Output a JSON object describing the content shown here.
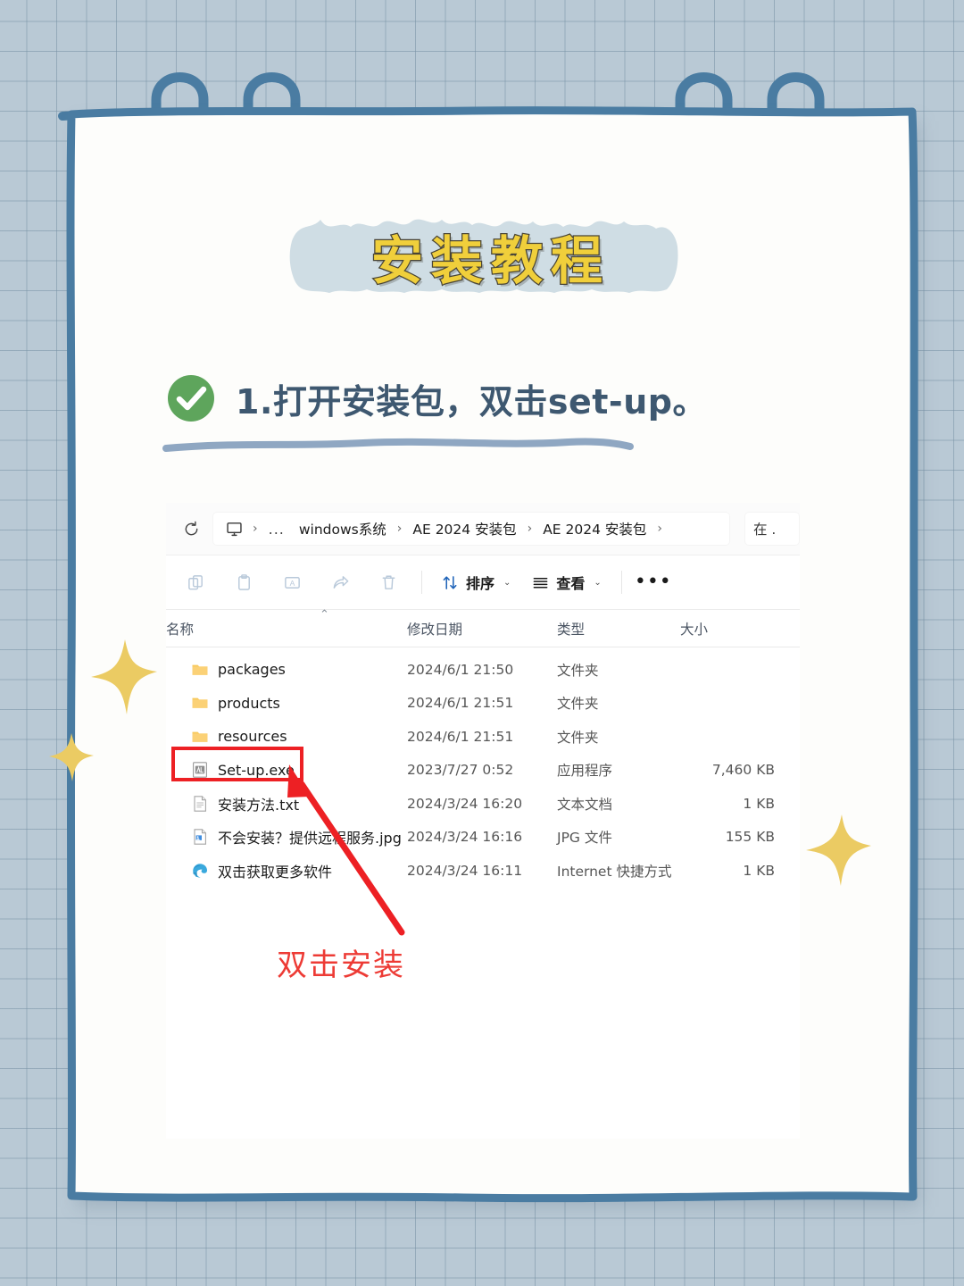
{
  "poster": {
    "title": "安装教程",
    "step": {
      "icon": "green-check-circle-icon",
      "text": "1.打开安装包，双击set-up。"
    },
    "annotation": "双击安装"
  },
  "colors": {
    "background": "#b9c9d5",
    "sheet": "#fdfdfb",
    "ring_blue": "#4a7ca2",
    "title_fill": "#F0CF3B",
    "title_stroke": "#4a4535",
    "highlight_brush": "#cfdde4",
    "heading_text": "#3e5870",
    "check_green": "#5EA55C",
    "star_yellow": "#EBCB63",
    "annotation_red": "#ED3B35",
    "highlight_box_red": "#ED2024"
  },
  "explorer": {
    "address_bar": {
      "refresh_icon": "refresh-icon",
      "pc_icon": "this-pc-monitor-icon",
      "breadcrumb": [
        {
          "label": "›",
          "type": "separator"
        },
        {
          "label": "...",
          "type": "overflow"
        },
        {
          "label": "windows系统",
          "type": "crumb"
        },
        {
          "label": "›",
          "type": "separator"
        },
        {
          "label": "AE 2024 安装包",
          "type": "crumb"
        },
        {
          "label": "›",
          "type": "separator"
        },
        {
          "label": "AE 2024 安装包",
          "type": "crumb"
        },
        {
          "label": "›",
          "type": "separator"
        }
      ],
      "search_partial": "在 ."
    },
    "command_bar": {
      "icons": [
        "copy-icon",
        "paste-icon",
        "rename-icon",
        "share-icon",
        "delete-icon"
      ],
      "sort": {
        "label": "排序",
        "icon": "sort-arrows-icon",
        "chevron": "⌄"
      },
      "view": {
        "label": "查看",
        "icon": "view-lines-icon",
        "chevron": "⌄"
      },
      "more": "•••"
    },
    "columns": {
      "name": "名称",
      "date": "修改日期",
      "type": "类型",
      "size": "大小",
      "sort_caret": "⌃"
    },
    "files": [
      {
        "name": "packages",
        "icon": "folder-icon",
        "date": "2024/6/1 21:50",
        "type": "文件夹",
        "size": ""
      },
      {
        "name": "products",
        "icon": "folder-icon",
        "date": "2024/6/1 21:51",
        "type": "文件夹",
        "size": ""
      },
      {
        "name": "resources",
        "icon": "folder-icon",
        "date": "2024/6/1 21:51",
        "type": "文件夹",
        "size": ""
      },
      {
        "name": "Set-up.exe",
        "icon": "exe-app-icon",
        "date": "2023/7/27 0:52",
        "type": "应用程序",
        "size": "7,460 KB"
      },
      {
        "name": "安装方法.txt",
        "icon": "txt-file-icon",
        "date": "2024/3/24 16:20",
        "type": "文本文档",
        "size": "1 KB"
      },
      {
        "name": "不会安装？提供远程服务.jpg",
        "icon": "jpg-file-icon",
        "date": "2024/3/24 16:16",
        "type": "JPG 文件",
        "size": "155 KB"
      },
      {
        "name": "双击获取更多软件",
        "icon": "edge-shortcut-icon",
        "date": "2024/3/24 16:11",
        "type": "Internet 快捷方式",
        "size": "1 KB"
      }
    ]
  }
}
